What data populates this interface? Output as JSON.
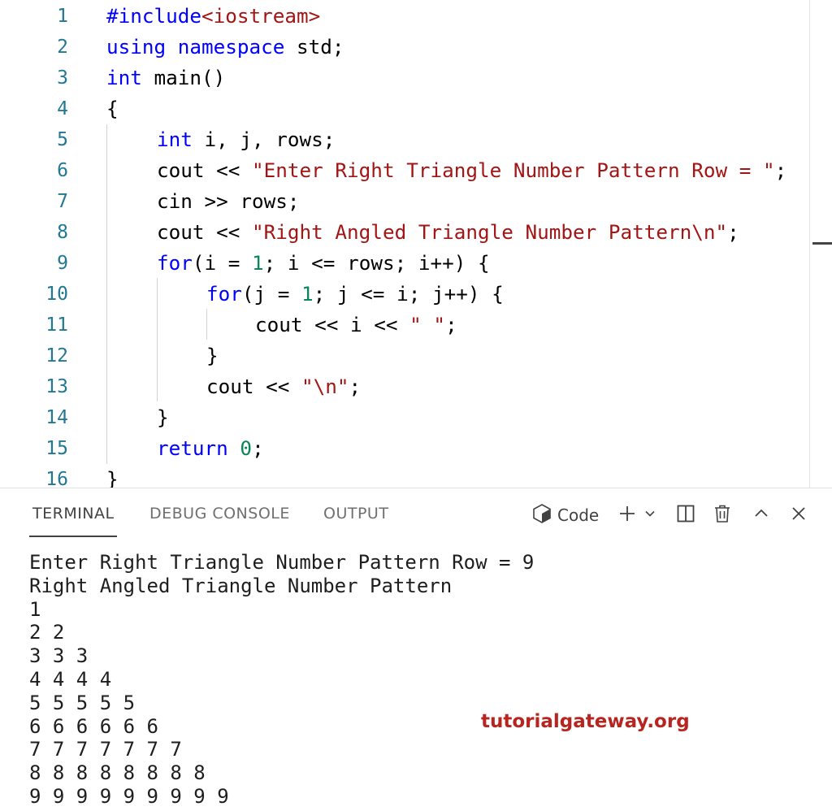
{
  "editor": {
    "line_numbers": [
      "1",
      "2",
      "3",
      "4",
      "5",
      "6",
      "7",
      "8",
      "9",
      "10",
      "11",
      "12",
      "13",
      "14",
      "15",
      "16"
    ],
    "tokens": {
      "l1_a": "#include",
      "l1_b": "<iostream>",
      "l2_a": "using namespace",
      "l2_b": " std;",
      "l3_a": "int",
      "l3_b": " main()",
      "l4": "{",
      "l5_a": "int",
      "l5_b": " i, j, rows;",
      "l6_a": "cout << ",
      "l6_b": "\"Enter Right Triangle Number Pattern Row = \"",
      "l6_c": ";",
      "l7": "cin >> rows;",
      "l8_a": "cout << ",
      "l8_b": "\"Right Angled Triangle Number Pattern\\n\"",
      "l8_c": ";",
      "l9_a": "for",
      "l9_b": "(i = ",
      "l9_c": "1",
      "l9_d": "; i <= rows; i++) {",
      "l10_a": "for",
      "l10_b": "(j = ",
      "l10_c": "1",
      "l10_d": "; j <= i; j++) {",
      "l11_a": "cout << i << ",
      "l11_b": "\" \"",
      "l11_c": ";",
      "l12": "}",
      "l13_a": "cout << ",
      "l13_b": "\"\\n\"",
      "l13_c": ";",
      "l14": "}",
      "l15_a": "return",
      "l15_b": " ",
      "l15_c": "0",
      "l15_d": ";",
      "l16": "}"
    }
  },
  "panel": {
    "tabs": [
      "TERMINAL",
      "DEBUG CONSOLE",
      "OUTPUT"
    ],
    "active_tab": "TERMINAL",
    "shell_label": "Code",
    "icons": [
      "shell-icon",
      "plus-icon",
      "chevron-down-icon",
      "split-icon",
      "trash-icon",
      "chevron-up-icon",
      "close-icon"
    ]
  },
  "terminal": {
    "lines": [
      "Enter Right Triangle Number Pattern Row = 9",
      "Right Angled Triangle Number Pattern",
      "1",
      "2 2",
      "3 3 3",
      "4 4 4 4",
      "5 5 5 5 5",
      "6 6 6 6 6 6",
      "7 7 7 7 7 7 7",
      "8 8 8 8 8 8 8 8",
      "9 9 9 9 9 9 9 9 9"
    ]
  },
  "watermark": "tutorialgateway.org",
  "colors": {
    "keyword": "#0000ff",
    "string": "#a31515",
    "number": "#098658",
    "line_number": "#237893",
    "watermark": "#b8241f"
  }
}
